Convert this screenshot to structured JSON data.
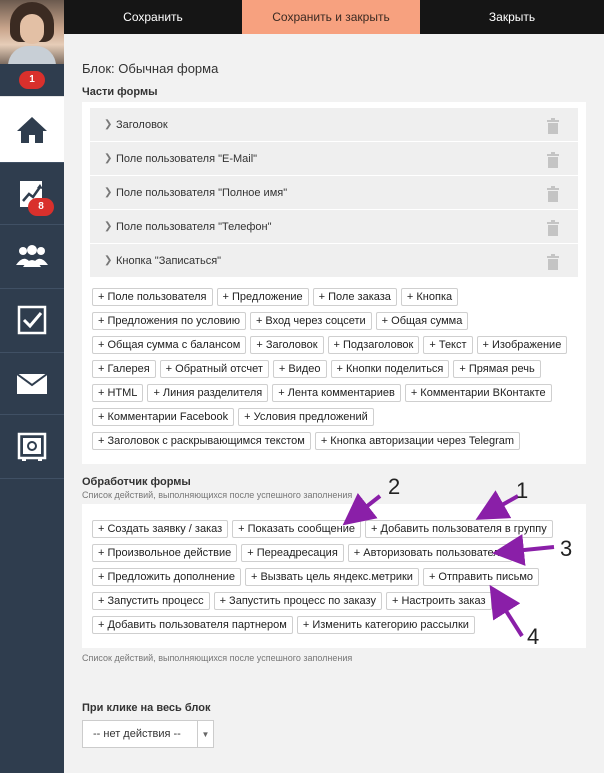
{
  "user": {
    "notification_count": "1"
  },
  "sidebar": {
    "items": [
      {
        "icon": "home-icon",
        "badge": ""
      },
      {
        "icon": "chart-trend-icon",
        "badge": "8"
      },
      {
        "icon": "users-icon",
        "badge": ""
      },
      {
        "icon": "checkbox-icon",
        "badge": ""
      },
      {
        "icon": "mail-icon",
        "badge": ""
      },
      {
        "icon": "safe-icon",
        "badge": ""
      }
    ]
  },
  "toolbar": {
    "save_label": "Сохранить",
    "save_close_label": "Сохранить и закрыть",
    "close_label": "Закрыть"
  },
  "block_title": "Блок: Обычная форма",
  "parts": {
    "title": "Части формы",
    "rows": [
      "Заголовок",
      "Поле пользователя \"E-Mail\"",
      "Поле пользователя \"Полное имя\"",
      "Поле пользователя \"Телефон\"",
      "Кнопка \"Записаться\""
    ],
    "chips": [
      "+ Поле пользователя",
      "+ Предложение",
      "+ Поле заказа",
      "+ Кнопка",
      "+ Предложения по условию",
      "+ Вход через соцсети",
      "+ Общая сумма",
      "+ Общая сумма с балансом",
      "+ Заголовок",
      "+ Подзаголовок",
      "+ Текст",
      "+ Изображение",
      "+ Галерея",
      "+ Обратный отсчет",
      "+ Видео",
      "+ Кнопки поделиться",
      "+ Прямая речь",
      "+ HTML",
      "+ Линия разделителя",
      "+ Лента комментариев",
      "+ Комментарии ВКонтакте",
      "+ Комментарии Facebook",
      "+ Условия предложений",
      "+ Заголовок с раскрывающимся текстом",
      "+ Кнопка авторизации через Telegram"
    ]
  },
  "handler": {
    "title": "Обработчик формы",
    "subtitle": "Список действий, выполняющихся после успешного заполнения",
    "footer": "Список действий, выполняющихся после успешного заполнения",
    "chips": [
      "+ Создать заявку / заказ",
      "+ Показать сообщение",
      "+ Добавить пользователя в группу",
      "+ Произвольное действие",
      "+ Переадресация",
      "+ Авторизовать пользователя",
      "+ Предложить дополнение",
      "+ Вызвать цель яндекс.метрики",
      "+ Отправить письмо",
      "+ Запустить процесс",
      "+ Запустить процесс по заказу",
      "+ Настроить заказ",
      "+ Добавить пользователя партнером",
      "+ Изменить категорию рассылки"
    ]
  },
  "click_action": {
    "title": "При клике на весь блок",
    "selected": "-- нет действия --"
  },
  "annotations": {
    "color": "#8a1fa8",
    "labels": [
      "1",
      "2",
      "3",
      "4"
    ]
  }
}
